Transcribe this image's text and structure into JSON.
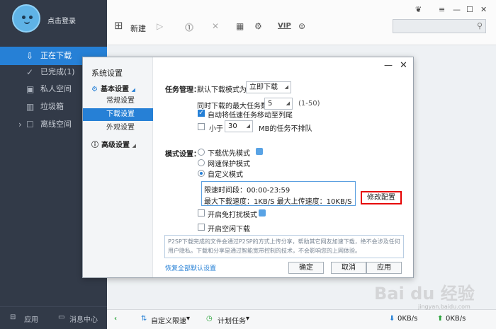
{
  "sidebar": {
    "login": "点击登录",
    "items": [
      {
        "label": "正在下载",
        "icon": "download-icon"
      },
      {
        "label": "已完成(1)",
        "icon": "check-circle-icon"
      },
      {
        "label": "私人空间",
        "icon": "lock-icon"
      },
      {
        "label": "垃圾箱",
        "icon": "trash-icon"
      },
      {
        "label": "离线空间",
        "icon": "cloud-icon"
      }
    ],
    "apps": "应用",
    "messages": "消息中心"
  },
  "toolbar": {
    "new_label": "新建",
    "icons": [
      "plus-icon",
      "play-icon",
      "pause-icon",
      "delete-icon",
      "grid-icon",
      "settings-icon",
      "vip-icon",
      "upgrade-icon"
    ],
    "vip_label": "VIP"
  },
  "statusbar": {
    "speed_limit": "自定义限速",
    "schedule": "计划任务",
    "down_speed": "0KB/s",
    "up_speed": "0KB/s"
  },
  "dialog": {
    "title": "系统设置",
    "nav": {
      "basic": "基本设置",
      "general": "常规设置",
      "download": "下载设置",
      "appearance": "外观设置",
      "advanced": "高级设置"
    },
    "task": {
      "section": "任务管理：",
      "default_mode_label": "默认下载模式为",
      "default_mode_value": "立即下载",
      "max_tasks_label": "同时下载的最大任务数",
      "max_tasks_value": "5",
      "max_tasks_range": "(1-50)",
      "auto_move": "自动将低速任务移动至列尾",
      "auto_move_checked": true,
      "less_than": "小于",
      "less_value": "30",
      "less_suffix": "MB的任务不排队",
      "less_checked": false
    },
    "mode": {
      "section": "模式设置：",
      "options": [
        "下载优先模式",
        "网速保护模式",
        "自定义模式"
      ],
      "selected": 2,
      "time_range": "限速时间段：00:00-23:59",
      "max_speeds": "最大下载速度：1KB/S  最大上传速度：10KB/S",
      "modify": "修改配置",
      "no_disturb": "开启免打扰模式",
      "idle_download": "开启空闲下载"
    },
    "note": "P2SP下载完成的文件会通过P2SP的方式上传分享，帮助其它网友加速下载，绝不会涉及任何用户隐私。下载和分享是通过智能宽带控制的技术，不会影响您的上网体验。",
    "restore": "恢复全部默认设置",
    "ok": "确定",
    "cancel": "取消",
    "apply": "应用"
  },
  "watermark": "Bai du 经验",
  "watermark_sub": "jingyan.baidu.com"
}
